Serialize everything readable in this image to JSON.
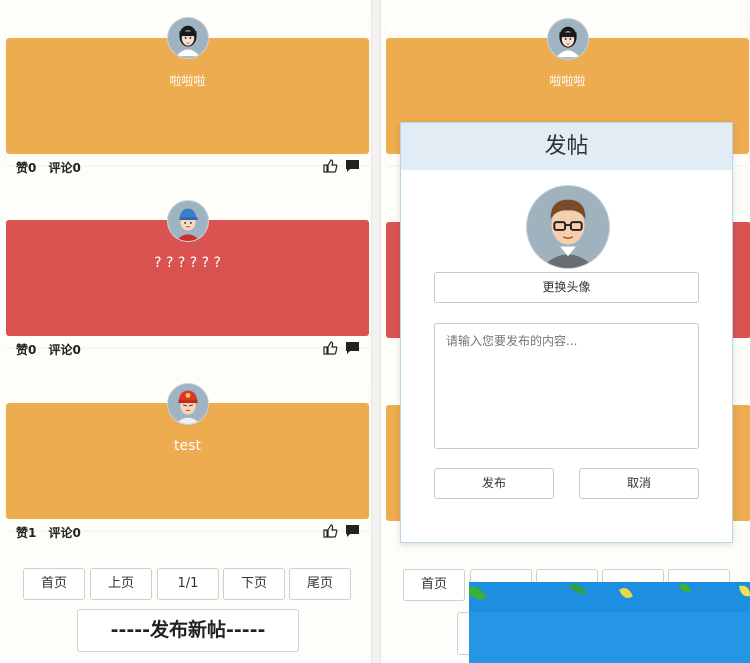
{
  "left_panel": {
    "posts": [
      {
        "text": "啦啦啦",
        "likes_label": "赞0",
        "comments_label": "评论0",
        "bg": "#ecac4f",
        "avatar": "girl-avatar"
      },
      {
        "text": "? ? ? ? ? ?",
        "likes_label": "赞0",
        "comments_label": "评论0",
        "bg": "#d95450",
        "avatar": "boy-blue-cap-avatar"
      },
      {
        "text": "test",
        "likes_label": "赞1",
        "comments_label": "评论0",
        "bg": "#ecac4f",
        "avatar": "boy-red-cap-avatar"
      }
    ],
    "pagination": {
      "first": "首页",
      "prev": "上页",
      "current": "1/1",
      "next": "下页",
      "last": "尾页"
    },
    "publish_button": "-----发布新帖-----"
  },
  "right_panel": {
    "post_text": "啦啦啦",
    "pagination": {
      "first": "首页"
    }
  },
  "modal": {
    "title": "发帖",
    "avatar": "glasses-man-avatar",
    "change_avatar": "更换头像",
    "content_placeholder": "请输入您要发布的内容...",
    "submit": "发布",
    "cancel": "取消"
  },
  "icons": {
    "like": "thumbs-up-icon",
    "comment": "comment-icon"
  },
  "colors": {
    "orange_card": "#ecac4f",
    "red_card": "#d95450",
    "modal_header": "#e2ecf5",
    "overlay_blue": "#1e8fe0"
  }
}
